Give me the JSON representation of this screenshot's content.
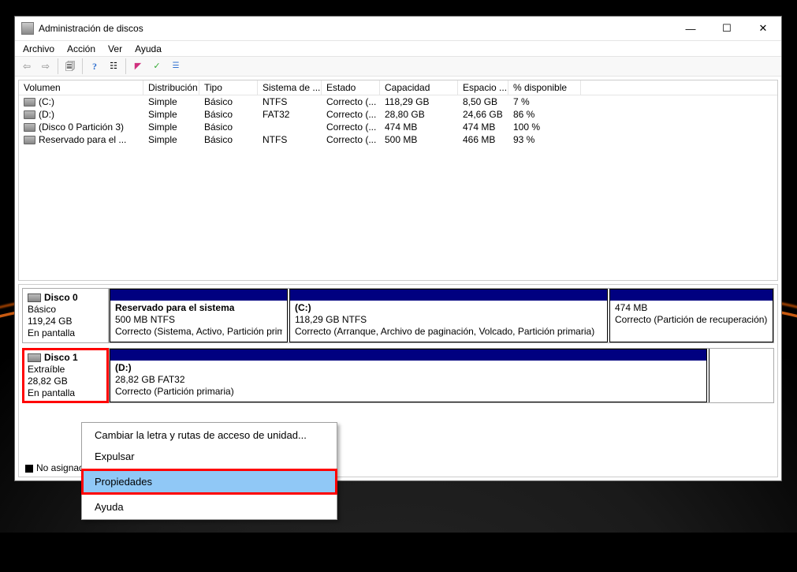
{
  "window": {
    "title": "Administración de discos"
  },
  "menus": [
    "Archivo",
    "Acción",
    "Ver",
    "Ayuda"
  ],
  "columns": [
    "Volumen",
    "Distribución",
    "Tipo",
    "Sistema de ...",
    "Estado",
    "Capacidad",
    "Espacio ...",
    "% disponible"
  ],
  "volumes": [
    {
      "name": "(C:)",
      "dist": "Simple",
      "tipo": "Básico",
      "fs": "NTFS",
      "est": "Correcto (...",
      "cap": "118,29 GB",
      "esp": "8,50 GB",
      "pct": "7 %"
    },
    {
      "name": "(D:)",
      "dist": "Simple",
      "tipo": "Básico",
      "fs": "FAT32",
      "est": "Correcto (...",
      "cap": "28,80 GB",
      "esp": "24,66 GB",
      "pct": "86 %"
    },
    {
      "name": "(Disco 0 Partición 3)",
      "dist": "Simple",
      "tipo": "Básico",
      "fs": "",
      "est": "Correcto (...",
      "cap": "474 MB",
      "esp": "474 MB",
      "pct": "100 %"
    },
    {
      "name": "Reservado para el ...",
      "dist": "Simple",
      "tipo": "Básico",
      "fs": "NTFS",
      "est": "Correcto (...",
      "cap": "500 MB",
      "esp": "466 MB",
      "pct": "93 %"
    }
  ],
  "disk0": {
    "label": "Disco 0",
    "type": "Básico",
    "size": "119,24 GB",
    "state": "En pantalla",
    "p1": {
      "title": "Reservado para el sistema",
      "line": "500 MB NTFS",
      "state": "Correcto (Sistema, Activo, Partición primaria)"
    },
    "p2": {
      "title": "(C:)",
      "line": "118,29 GB NTFS",
      "state": "Correcto (Arranque, Archivo de paginación, Volcado, Partición primaria)"
    },
    "p3": {
      "title": "",
      "line": "474 MB",
      "state": "Correcto (Partición de recuperación)"
    }
  },
  "disk1": {
    "label": "Disco 1",
    "type": "Extraíble",
    "size": "28,82 GB",
    "state": "En pantalla",
    "p1": {
      "title": "(D:)",
      "line": "28,82 GB FAT32",
      "state": "Correcto (Partición primaria)"
    }
  },
  "legend": "No asignado",
  "ctx": {
    "i1": "Cambiar la letra y rutas de acceso de unidad...",
    "i2": "Expulsar",
    "i3": "Propiedades",
    "i4": "Ayuda"
  }
}
